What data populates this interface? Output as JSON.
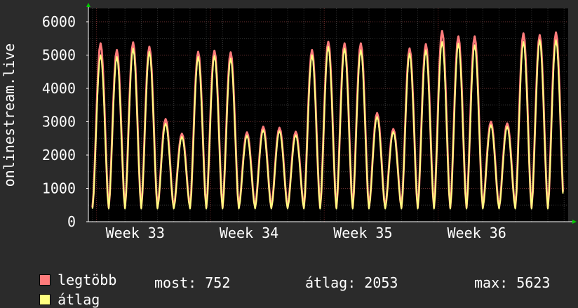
{
  "chart_data": {
    "type": "line",
    "ylabel": "onlinestream.live",
    "ylim": [
      0,
      6400
    ],
    "yticks": [
      0,
      1000,
      2000,
      3000,
      4000,
      5000,
      6000
    ],
    "xticks": [
      "Week 33",
      "Week 34",
      "Week 35",
      "Week 36"
    ],
    "grid": true,
    "legend_placement": "bottom-left",
    "series": [
      {
        "name": "legtöbb",
        "color": "#ff7b7b",
        "daily_peaks": [
          5350,
          5150,
          5380,
          5250,
          3080,
          2640,
          5100,
          5130,
          5080,
          2680,
          2850,
          2820,
          2700,
          5150,
          5400,
          5350,
          5350,
          3260,
          2780,
          5200,
          5330,
          5720,
          5560,
          5560,
          3000,
          2950,
          5650,
          5600,
          5680
        ]
      },
      {
        "name": "átlag",
        "color": "#ffff80",
        "daily_peaks": [
          5000,
          4950,
          5200,
          5100,
          2950,
          2550,
          4950,
          4980,
          4900,
          2580,
          2750,
          2720,
          2600,
          5000,
          5250,
          5200,
          5150,
          3150,
          2700,
          5050,
          5150,
          5400,
          5350,
          5300,
          2900,
          2850,
          5400,
          5450,
          5450
        ]
      }
    ]
  },
  "legend": {
    "max_label": "legtöbb",
    "avg_label": "átlag",
    "most": "most: 752",
    "atlag": "átlag: 2053",
    "max": "max: 5623"
  }
}
